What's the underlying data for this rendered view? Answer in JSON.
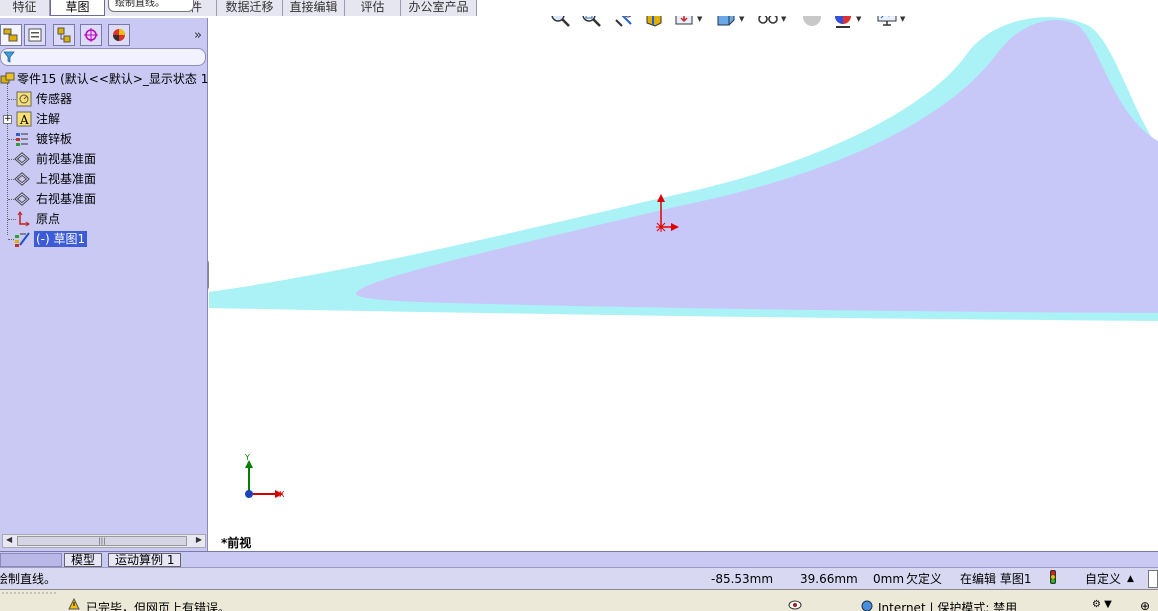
{
  "command_tabs": [
    "特征",
    "草图",
    "件",
    "数据迁移",
    "直接编辑",
    "评估",
    "办公室产品"
  ],
  "tooltip": {
    "text": "绘制直线。"
  },
  "feature_tree": {
    "root_label": "零件15 (默认<<默认>_显示状态 1",
    "items": [
      {
        "label": "传感器",
        "icon": "sensor-icon"
      },
      {
        "label": "注解",
        "icon": "annotation-icon"
      },
      {
        "label": "镀锌板",
        "icon": "material-icon"
      },
      {
        "label": "前视基准面",
        "icon": "plane-icon"
      },
      {
        "label": "上视基准面",
        "icon": "plane-icon"
      },
      {
        "label": "右视基准面",
        "icon": "plane-icon"
      },
      {
        "label": "原点",
        "icon": "origin-icon"
      },
      {
        "label": "(-) 草图1",
        "icon": "sketch-icon"
      }
    ],
    "filter_placeholder": ""
  },
  "graphics": {
    "view_label": "*前视",
    "triad_x": "X",
    "triad_y": "Y",
    "shape_fill": "#c8c8f8",
    "shape_edge": "#aaf2f6"
  },
  "bottom_tabs": {
    "model": "模型",
    "motion": "运动算例 1"
  },
  "status_bar": {
    "message": "绘制直线。",
    "x_coord": "-85.53mm",
    "y_coord": "39.66mm",
    "z_coord": "0mm",
    "definition": "欠定义",
    "editing": "在编辑 草图1",
    "units": "自定义"
  },
  "browser_status": {
    "message": "已完毕，但网页上有错误。",
    "zone": "Internet | 保护模式: 禁用"
  }
}
